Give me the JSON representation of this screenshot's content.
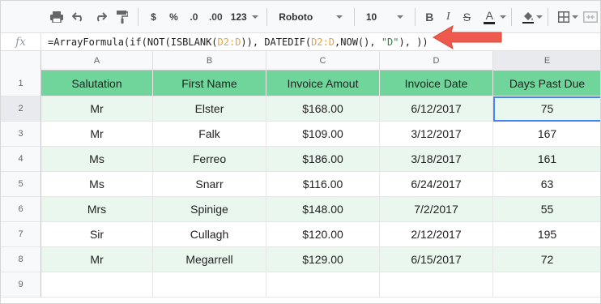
{
  "toolbar": {
    "zoom_more": "123",
    "currency": "$",
    "percent": "%",
    "dec_decrease": ".0",
    "dec_increase": ".00",
    "font": "Roboto",
    "font_size": "10",
    "bold": "B",
    "italic": "I",
    "strike": "S",
    "text_color": "A"
  },
  "formula_bar": {
    "fx": "fx",
    "parts": [
      "=ArrayFormula(if(NOT(ISBLANK(",
      "D2:D",
      ")), DATEDIF(",
      "D2:D",
      ",NOW(), ",
      "\"D\"",
      "), ))"
    ]
  },
  "columns": [
    "A",
    "B",
    "C",
    "D",
    "E"
  ],
  "headers": [
    "Salutation",
    "First Name",
    "Invoice Amout",
    "Invoice Date",
    "Days Past Due"
  ],
  "row_numbers": [
    "1",
    "2",
    "3",
    "4",
    "5",
    "6",
    "7",
    "8",
    "9"
  ],
  "rows": [
    [
      "Mr",
      "Elster",
      "$168.00",
      "6/12/2017",
      "75"
    ],
    [
      "Mr",
      "Falk",
      "$109.00",
      "3/12/2017",
      "167"
    ],
    [
      "Ms",
      "Ferreo",
      "$186.00",
      "3/18/2017",
      "161"
    ],
    [
      "Ms",
      "Snarr",
      "$116.00",
      "6/24/2017",
      "63"
    ],
    [
      "Mrs",
      "Spinige",
      "$148.00",
      "7/2/2017",
      "55"
    ],
    [
      "Sir",
      "Cullagh",
      "$120.00",
      "2/12/2017",
      "195"
    ],
    [
      "Mr",
      "Megarrell",
      "$129.00",
      "6/15/2017",
      "72"
    ],
    [
      "",
      "",
      "",
      "",
      ""
    ]
  ],
  "colors": {
    "header_fill": "#6fd59b",
    "band_fill": "#e9f7ee",
    "selection": "#4285f4",
    "arrow": "#ef5a4e",
    "range_ref": "#e8a33c",
    "string_literal": "#1a8f3a"
  },
  "selected_cell": "E2"
}
